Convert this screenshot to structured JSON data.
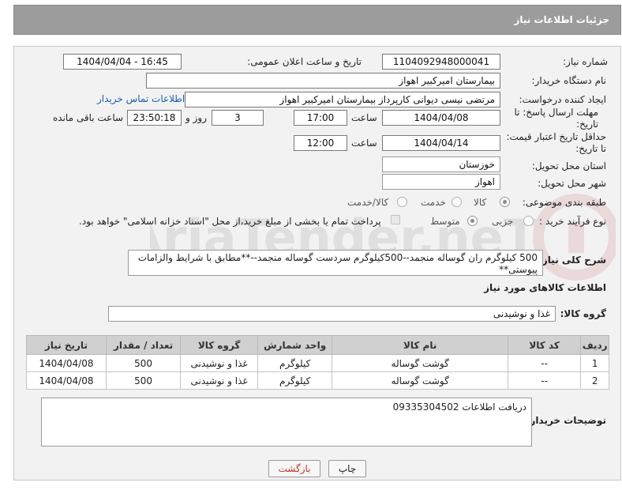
{
  "header": {
    "title": "جزئیات اطلاعات نیاز"
  },
  "fields": {
    "need_number_label": "شماره نیاز:",
    "need_number": "1104092948000041",
    "announce_label": "تاریخ و ساعت اعلان عمومی:",
    "announce_value": "1404/04/04 - 16:45",
    "buyer_org_label": "نام دستگاه خریدار:",
    "buyer_org": "بیمارستان امیرکبیر اهواز",
    "creator_label": "ایجاد کننده درخواست:",
    "creator": "مرتضی نیسی دیوانی کارپرداز بیمارستان امیرکبیر اهواز",
    "contact_link": "اطلاعات تماس خریدار",
    "deadline_label": "مهلت ارسال پاسخ: تا تاریخ:",
    "deadline_date": "1404/04/08",
    "hour_label": "ساعت",
    "deadline_hour": "17:00",
    "days_value": "3",
    "days_label": "روز و",
    "remaining_time": "23:50:18",
    "remaining_label": "ساعت باقی مانده",
    "validity_label": "حداقل تاریخ اعتبار قیمت: تا تاریخ:",
    "validity_date": "1404/04/14",
    "validity_hour": "12:00",
    "province_label": "استان محل تحویل:",
    "province": "خوزستان",
    "city_label": "شهر محل تحویل:",
    "city": "اهواز",
    "category_label": "طبقه بندی موضوعی:",
    "category_options": [
      "کالا",
      "خدمت",
      "کالا/خدمت"
    ],
    "process_label": "نوع فرآیند خرید :",
    "process_options": [
      "جزیی",
      "متوسط"
    ],
    "payment_note": "پرداخت تمام یا بخشی از مبلغ خرید،از محل \"اسناد خزانه اسلامی\" خواهد بود."
  },
  "description": {
    "label": "شرح کلی نیاز:",
    "text": "500 کیلوگرم ران گوساله منجمد--500کیلوگرم سردست گوساله منجمد--**مطابق با شرایط والزامات پیوستی**"
  },
  "goods": {
    "section_title": "اطلاعات کالاهای مورد نیاز",
    "group_label": "گروه کالا:",
    "group_value": "غذا و نوشیدنی",
    "columns": [
      "ردیف",
      "کد کالا",
      "نام کالا",
      "واحد شمارش",
      "گروه کالا",
      "تعداد / مقدار",
      "تاریخ نیاز"
    ],
    "rows": [
      [
        "1",
        "--",
        "گوشت گوساله",
        "کیلوگرم",
        "غذا و نوشیدنی",
        "500",
        "1404/04/08"
      ],
      [
        "2",
        "--",
        "گوشت گوساله",
        "کیلوگرم",
        "غذا و نوشیدنی",
        "500",
        "1404/04/08"
      ]
    ]
  },
  "buyer_notes": {
    "label": "توضیحات خریدار:",
    "text": "دریافت اطلاعات 09335304502"
  },
  "buttons": {
    "print": "چاپ",
    "back": "بازگشت"
  },
  "watermark": {
    "text": "AriaTender.neT"
  },
  "colors": {
    "header_bg": "#9c9c9c",
    "link": "#1a5bb5",
    "back_button_text": "#c0392b"
  }
}
